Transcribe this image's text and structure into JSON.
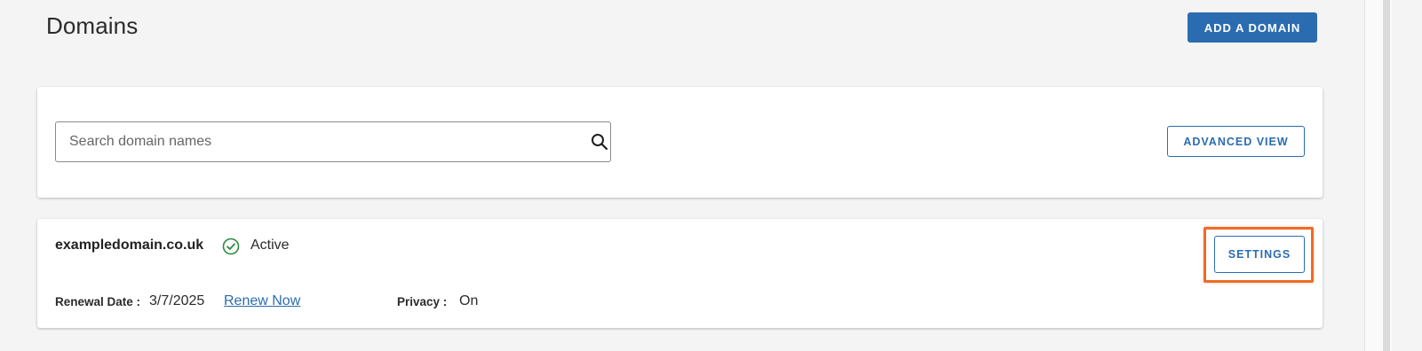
{
  "header": {
    "title": "Domains",
    "add_domain_label": "ADD A DOMAIN"
  },
  "search": {
    "placeholder": "Search domain names",
    "value": "",
    "advanced_view_label": "ADVANCED VIEW"
  },
  "domain": {
    "name": "exampledomain.co.uk",
    "status": "Active",
    "renewal_label": "Renewal Date :",
    "renewal_date": "3/7/2025",
    "renew_link": "Renew Now",
    "privacy_label": "Privacy :",
    "privacy_value": "On",
    "settings_label": "SETTINGS"
  },
  "icons": {
    "search": "search-icon",
    "status": "check-circle-icon"
  },
  "colors": {
    "primary": "#2b6cb0",
    "status_active": "#2e8b3e",
    "highlight": "#f06a26",
    "background": "#f4f4f4"
  }
}
